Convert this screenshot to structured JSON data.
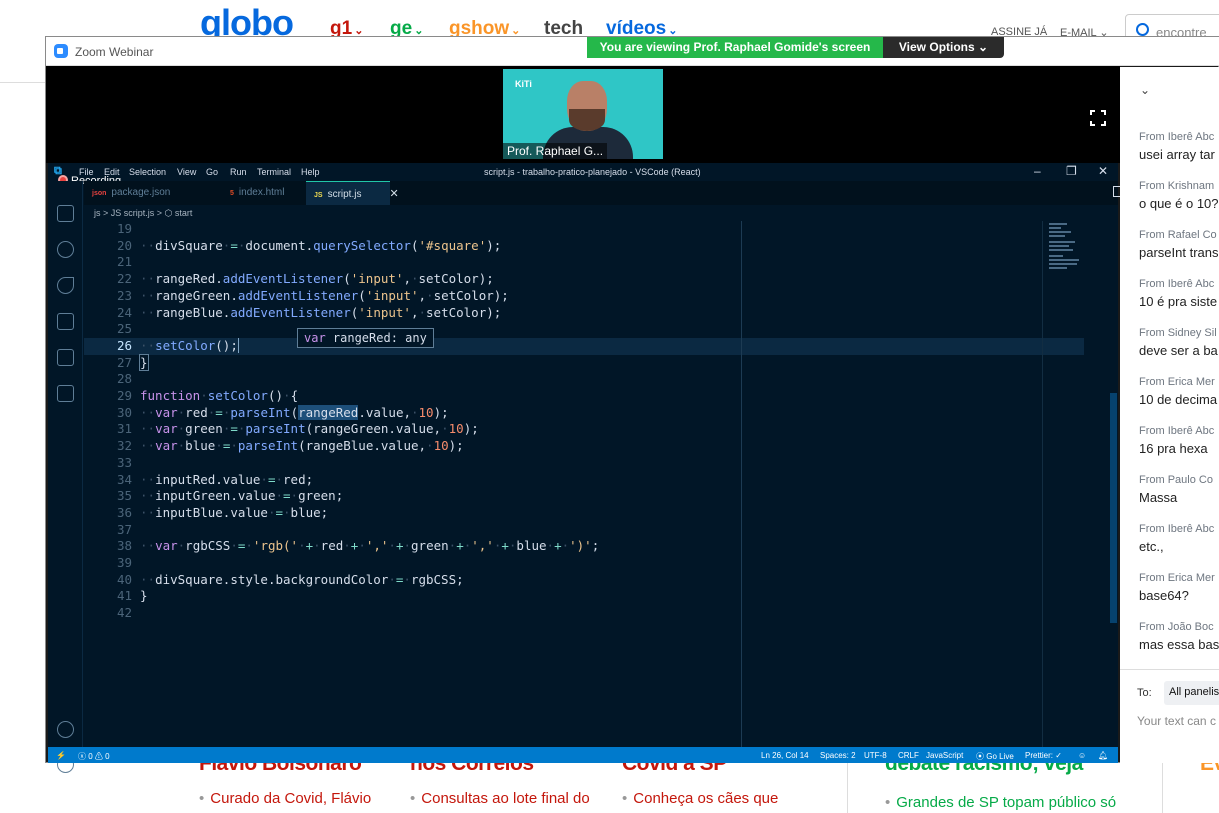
{
  "background": {
    "logo": "globo",
    "nav": [
      {
        "label": "g1",
        "color": "#c4170c"
      },
      {
        "label": "ge",
        "color": "#06aa48"
      },
      {
        "label": "gshow",
        "color": "#fa9528"
      },
      {
        "label": "tech",
        "color": "#444444"
      },
      {
        "label": "vídeos",
        "color": "#0669de"
      }
    ],
    "assine": "ASSINE JÁ",
    "email": "E-MAIL",
    "search_placeholder": "encontre",
    "headlines": [
      "Flávio Bolsonaro",
      "nos Correios",
      "Covid a SP",
      "debate racismo; veja",
      "Ev"
    ],
    "bullets": [
      "Curado da Covid, Flávio",
      "Consultas ao lote final do",
      "Conheça os cães que",
      "Grandes de SP topam público só"
    ]
  },
  "zoom": {
    "title": "Zoom Webinar",
    "banner": "You are viewing Prof. Raphael Gomide's screen",
    "view_options": "View Options",
    "speaker_name": "Prof. Raphael G..."
  },
  "vscode": {
    "menu": [
      "File",
      "Edit",
      "Selection",
      "View",
      "Go",
      "Run",
      "Terminal",
      "Help"
    ],
    "window_title": "script.js - trabalho-pratico-planejado - VSCode (React)",
    "recording": "Recording",
    "tabs": [
      {
        "icon": "json",
        "label": "package.json"
      },
      {
        "icon": "5",
        "label": "index.html"
      },
      {
        "icon": "JS",
        "label": "script.js"
      }
    ],
    "breadcrumb": "js > JS script.js > ⬡ start",
    "hover": "var rangeRed: any",
    "status": {
      "errors": "ⓧ 0 ⚠ 0",
      "position": "Ln 26, Col 14",
      "spaces": "Spaces: 2",
      "encoding": "UTF-8",
      "eol": "CRLF",
      "language": "JavaScript",
      "golive": "⦿ Go Live",
      "prettier": "Prettier: ✓"
    }
  },
  "chat": {
    "messages": [
      {
        "from": "From Iberê Abc",
        "text": "usei array tar"
      },
      {
        "from": "From Krishnam",
        "text": "o que é o 10?"
      },
      {
        "from": "From Rafael Co",
        "text": "parseInt trans"
      },
      {
        "from": "From Iberê Abc",
        "text": "10 é pra siste"
      },
      {
        "from": "From Sidney Sil",
        "text": "deve ser a ba"
      },
      {
        "from": "From Erica Mer",
        "text": "10 de decima"
      },
      {
        "from": "From Iberê Abc",
        "text": "16 pra hexa"
      },
      {
        "from": "From Paulo Co",
        "text": "Massa"
      },
      {
        "from": "From Iberê Abc",
        "text": "etc.,"
      },
      {
        "from": "From Erica Mer",
        "text": "base64?"
      },
      {
        "from": "From João Boc",
        "text": "mas essa bas"
      }
    ],
    "to_label": "To:",
    "to_value": "All panelis",
    "input_placeholder": "Your text can c"
  }
}
